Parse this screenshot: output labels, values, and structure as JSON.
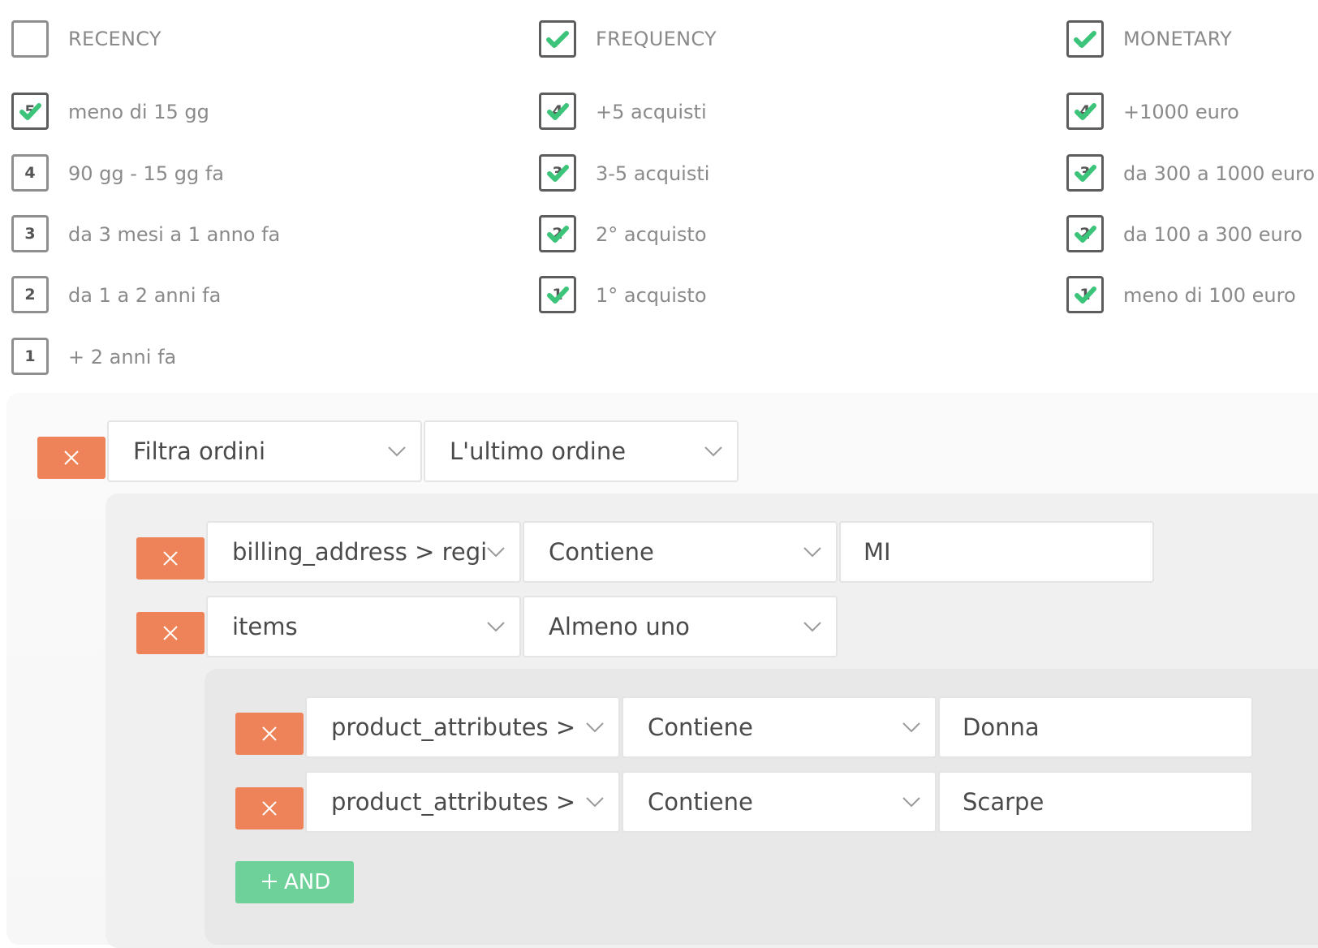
{
  "rfm": {
    "recency": {
      "header": "RECENCY",
      "options": [
        {
          "num": "5",
          "label": "meno di 15 gg"
        },
        {
          "num": "4",
          "label": "90 gg - 15 gg fa"
        },
        {
          "num": "3",
          "label": "da 3 mesi a 1 anno fa"
        },
        {
          "num": "2",
          "label": "da 1 a 2 anni fa"
        },
        {
          "num": "1",
          "label": "+ 2 anni fa"
        }
      ]
    },
    "frequency": {
      "header": "FREQUENCY",
      "options": [
        {
          "num": "4",
          "label": "+5 acquisti"
        },
        {
          "num": "3",
          "label": "3-5 acquisti"
        },
        {
          "num": "2",
          "label": "2° acquisto"
        },
        {
          "num": "1",
          "label": "1° acquisto"
        }
      ]
    },
    "monetary": {
      "header": "MONETARY",
      "options": [
        {
          "num": "4",
          "label": "+1000 euro"
        },
        {
          "num": "3",
          "label": "da 300 a 1000 euro"
        },
        {
          "num": "2",
          "label": "da 100 a 300 euro"
        },
        {
          "num": "1",
          "label": "meno di 100 euro"
        }
      ]
    }
  },
  "filter": {
    "level1": {
      "field": "Filtra ordini",
      "operator": "L'ultimo ordine"
    },
    "level2": [
      {
        "field": "billing_address > regi",
        "operator": "Contiene",
        "value": "MI"
      },
      {
        "field": "items",
        "operator": "Almeno uno"
      }
    ],
    "level3": [
      {
        "field": "product_attributes >",
        "operator": "Contiene",
        "value": "Donna"
      },
      {
        "field": "product_attributes >",
        "operator": "Contiene",
        "value": "Scarpe"
      }
    ],
    "add_and_label": "AND"
  },
  "colors": {
    "check_green": "#3cc57a",
    "remove_button": "#ee8259",
    "and_button": "#6fd19a"
  }
}
